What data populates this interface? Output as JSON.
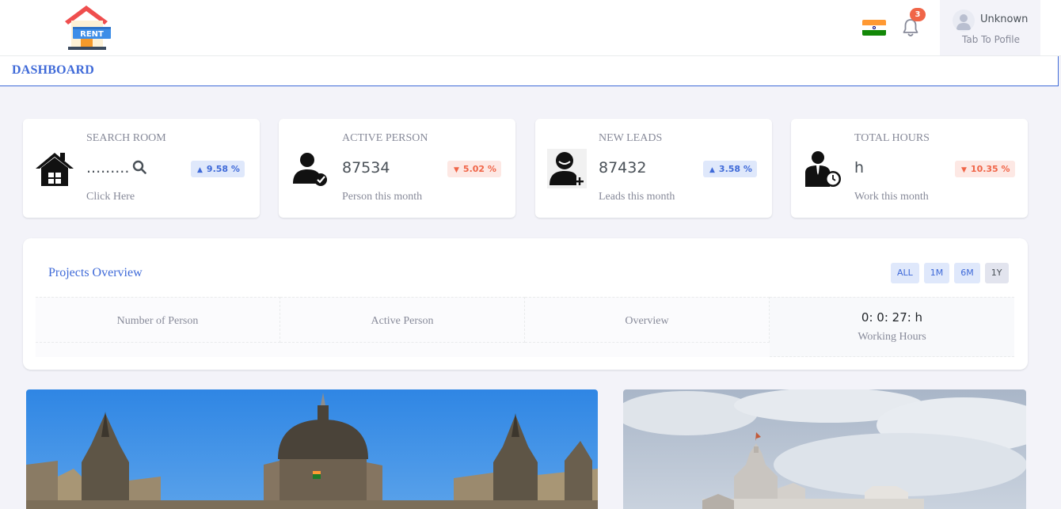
{
  "header": {
    "logo_text": "RENT",
    "notification_count": "3",
    "profile": {
      "name": "Unknown",
      "subtitle": "Tab To Pofile"
    },
    "flag_icon": "india-flag-icon"
  },
  "page": {
    "title": "DASHBOARD"
  },
  "cards": [
    {
      "label": "SEARCH ROOM",
      "value": ".........",
      "sub": "Click Here",
      "badge": "9.58 %",
      "trend": "up",
      "icon": "house-icon"
    },
    {
      "label": "ACTIVE PERSON",
      "value": "87534",
      "sub": "Person this month",
      "badge": "5.02 %",
      "trend": "down",
      "icon": "user-check-icon"
    },
    {
      "label": "NEW LEADS",
      "value": "87432",
      "sub": "Leads this month",
      "badge": "3.58 %",
      "trend": "up",
      "icon": "user-add-icon"
    },
    {
      "label": "TOTAL HOURS",
      "value": "h",
      "sub": "Work this month",
      "badge": "10.35 %",
      "trend": "down",
      "icon": "businessman-clock-icon"
    }
  ],
  "overview": {
    "title": "Projects Overview",
    "periods": [
      "ALL",
      "1M",
      "6M",
      "1Y"
    ],
    "active_period": "1Y",
    "columns": [
      "Number of Person",
      "Active Person",
      "Overview"
    ],
    "timer": {
      "value": "0: 0: 27: h",
      "label": "Working Hours"
    }
  },
  "colors": {
    "accent": "#3f6ad8",
    "danger": "#f06548",
    "background": "#f3f3f9"
  }
}
